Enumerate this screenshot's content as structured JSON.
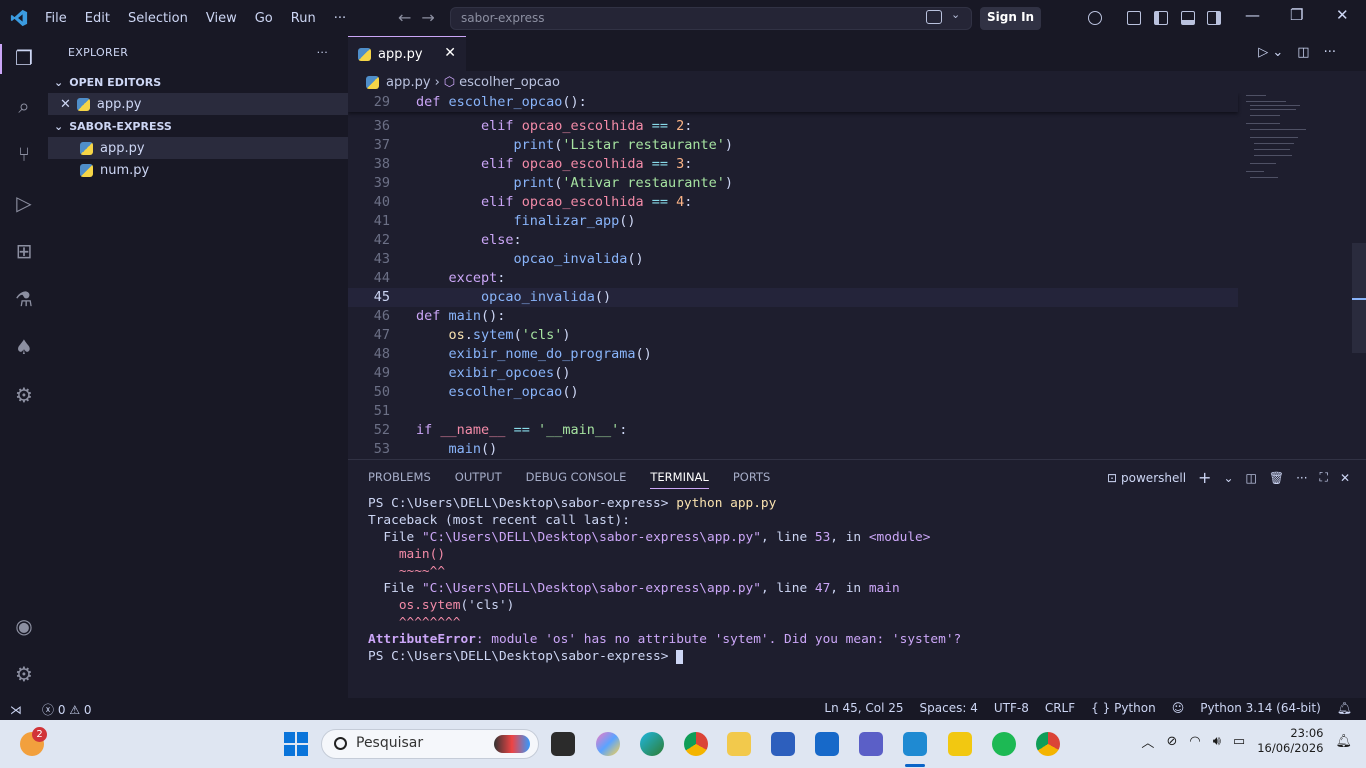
{
  "titlebar": {
    "menu": [
      "File",
      "Edit",
      "Selection",
      "View",
      "Go",
      "Run",
      "···"
    ],
    "search_text": "sabor-express",
    "signin_label": "Sign In"
  },
  "sidebar": {
    "title": "EXPLORER",
    "more": "···",
    "open_editors_label": "OPEN EDITORS",
    "open_editors": [
      {
        "name": "app.py"
      }
    ],
    "folder_label": "SABOR-EXPRESS",
    "files": [
      {
        "name": "app.py"
      },
      {
        "name": "num.py"
      }
    ]
  },
  "editor": {
    "tab_label": "app.py",
    "breadcrumb": {
      "file": "app.py",
      "symbol": "escolher_opcao"
    },
    "sticky": {
      "ln": "29",
      "text": "def escolher_opcao():"
    },
    "lines": [
      {
        "ln": "36",
        "text": "        elif opcao_escolhida == 2:"
      },
      {
        "ln": "37",
        "text": "            print('Listar restaurante')"
      },
      {
        "ln": "38",
        "text": "        elif opcao_escolhida == 3:"
      },
      {
        "ln": "39",
        "text": "            print('Ativar restaurante')"
      },
      {
        "ln": "40",
        "text": "        elif opcao_escolhida == 4:"
      },
      {
        "ln": "41",
        "text": "            finalizar_app()"
      },
      {
        "ln": "42",
        "text": "        else:"
      },
      {
        "ln": "43",
        "text": "            opcao_invalida()"
      },
      {
        "ln": "44",
        "text": "    except:"
      },
      {
        "ln": "45",
        "text": "        opcao_invalida()"
      },
      {
        "ln": "46",
        "text": "def main():"
      },
      {
        "ln": "47",
        "text": "    os.sytem('cls')"
      },
      {
        "ln": "48",
        "text": "    exibir_nome_do_programa()"
      },
      {
        "ln": "49",
        "text": "    exibir_opcoes()"
      },
      {
        "ln": "50",
        "text": "    escolher_opcao()"
      },
      {
        "ln": "51",
        "text": ""
      },
      {
        "ln": "52",
        "text": "if __name__ == '__main__':"
      },
      {
        "ln": "53",
        "text": "    main()"
      }
    ]
  },
  "panel": {
    "tabs": [
      "PROBLEMS",
      "OUTPUT",
      "DEBUG CONSOLE",
      "TERMINAL",
      "PORTS"
    ],
    "active_tab": "TERMINAL",
    "shell_label": "powershell",
    "terminal": {
      "prompt1": "PS C:\\Users\\DELL\\Desktop\\sabor-express> ",
      "cmd1": "python app.py",
      "traceback": "Traceback (most recent call last):",
      "file1_pre": "  File ",
      "file1_path": "\"C:\\Users\\DELL\\Desktop\\sabor-express\\app.py\"",
      "file1_mid": ", line ",
      "file1_line": "53",
      "file1_in": ", in ",
      "file1_func": "<module>",
      "code1": "    main()",
      "caret1": "    ~~~~^^",
      "file2_pre": "  File ",
      "file2_path": "\"C:\\Users\\DELL\\Desktop\\sabor-express\\app.py\"",
      "file2_mid": ", line ",
      "file2_line": "47",
      "file2_in": ", in ",
      "file2_func": "main",
      "code2a": "    os.sytem",
      "code2b": "('cls')",
      "caret2": "    ^^^^^^^^",
      "err_name": "AttributeError",
      "err_msg": ": module 'os' has no attribute 'sytem'. Did you mean: 'system'?",
      "prompt2": "PS C:\\Users\\DELL\\Desktop\\sabor-express> "
    }
  },
  "statusbar": {
    "errors": "0",
    "warnings": "0",
    "position": "Ln 45, Col 25",
    "spaces": "Spaces: 4",
    "encoding": "UTF-8",
    "eol": "CRLF",
    "language": "Python",
    "interpreter": "Python 3.14 (64-bit)"
  },
  "taskbar": {
    "weather_badge": "2",
    "search_placeholder": "Pesquisar",
    "time": "23:06",
    "date": "16/06/2026"
  }
}
